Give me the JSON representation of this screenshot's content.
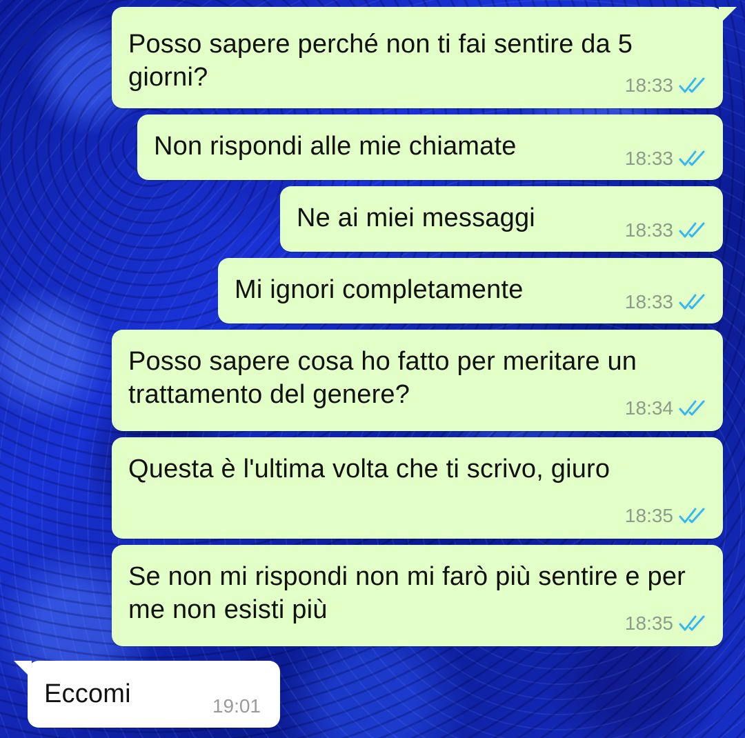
{
  "messages": [
    {
      "direction": "out",
      "text": "Posso sapere perché non ti fai sentire da 5 giorni?",
      "time": "18:33",
      "status": "read"
    },
    {
      "direction": "out",
      "text": "Non rispondi alle mie chiamate",
      "time": "18:33",
      "status": "read"
    },
    {
      "direction": "out",
      "text": "Ne ai miei messaggi",
      "time": "18:33",
      "status": "read"
    },
    {
      "direction": "out",
      "text": "Mi ignori completamente",
      "time": "18:33",
      "status": "read"
    },
    {
      "direction": "out",
      "text": "Posso sapere cosa ho fatto per meritare un trattamento del genere?",
      "time": "18:34",
      "status": "read"
    },
    {
      "direction": "out",
      "text": "Questa è l'ultima volta che ti scrivo, giuro",
      "time": "18:35",
      "status": "read"
    },
    {
      "direction": "out",
      "text": "Se non mi rispondi non mi farò più sentire e per me non esisti più",
      "time": "18:35",
      "status": "read"
    },
    {
      "direction": "in",
      "text": "Eccomi",
      "time": "19:01"
    }
  ],
  "colors": {
    "outgoing_bubble": "#e2ffc7",
    "incoming_bubble": "#ffffff",
    "read_tick": "#34b7f1",
    "background": "#0a1fa8"
  },
  "icons": {
    "read_receipt": "double-check-icon",
    "wallpaper": "blue-roses-wallpaper"
  }
}
